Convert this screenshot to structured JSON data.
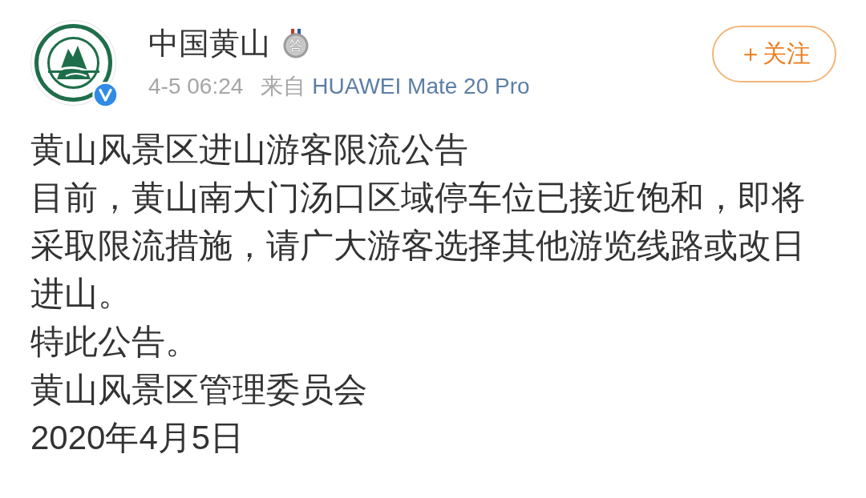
{
  "author": {
    "name": "中国黄山",
    "badge": "答",
    "verified": true
  },
  "meta": {
    "time": "4-5 06:24",
    "source_prefix": "来自",
    "source": "HUAWEI Mate 20 Pro"
  },
  "follow_button": {
    "label": "＋关注"
  },
  "post": {
    "title": "黄山风景区进山游客限流公告",
    "body": "目前，黄山南大门汤口区域停车位已接近饱和，即将采取限流措施，请广大游客选择其他游览线路或改日进山。",
    "closing": "特此公告。",
    "signature": "黄山风景区管理委员会",
    "date": "2020年4月5日"
  }
}
